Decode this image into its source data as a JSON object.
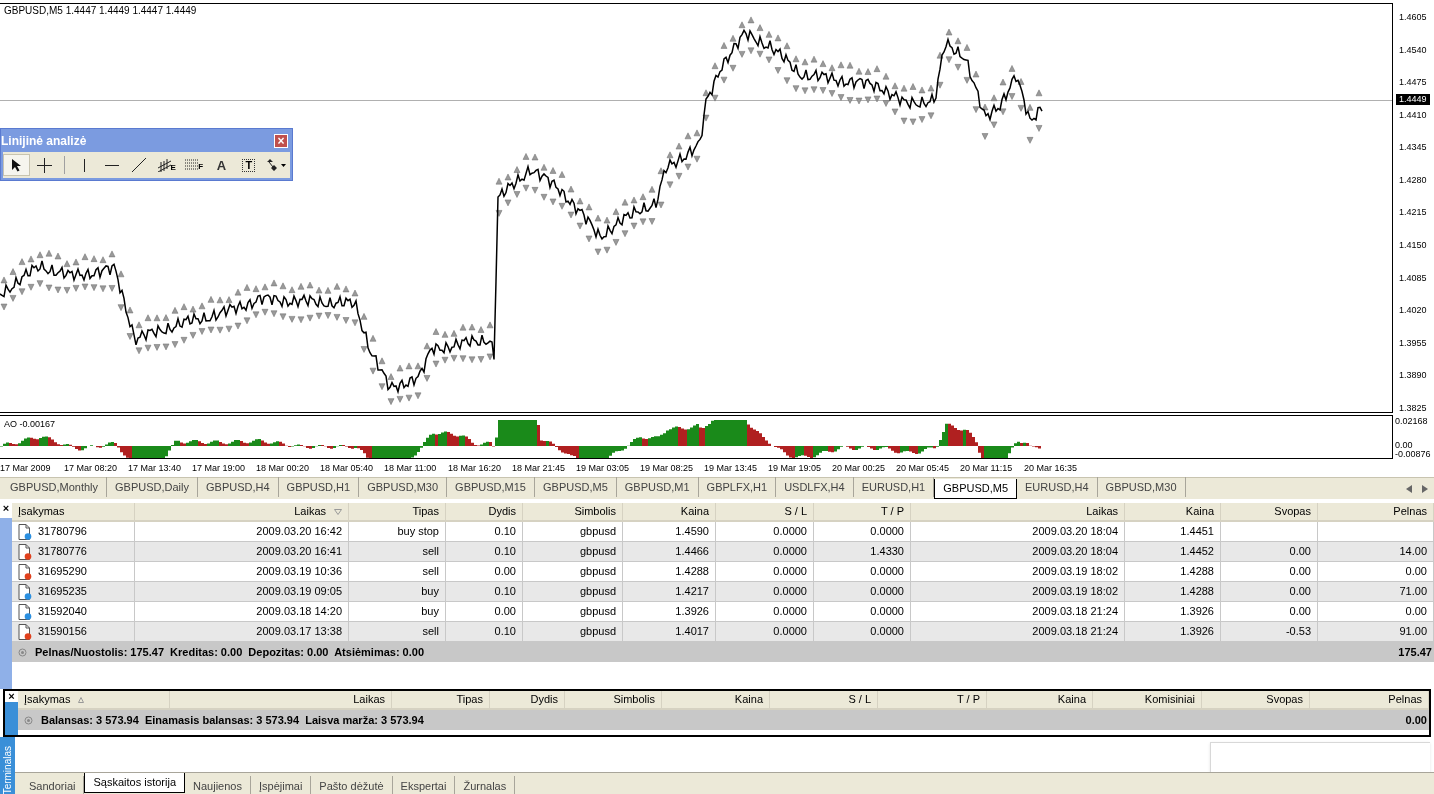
{
  "chart": {
    "header": "GBPUSD,M5  1.4447 1.4449 1.4447 1.4449",
    "price_axis": {
      "labels": [
        "1.4605",
        "1.4540",
        "1.4475",
        "1.4410",
        "1.4345",
        "1.4280",
        "1.4215",
        "1.4150",
        "1.4085",
        "1.4020",
        "1.3955",
        "1.3890",
        "1.3825"
      ],
      "current": "1.4449"
    },
    "indicator": {
      "label": "AO -0.00167",
      "axis": [
        "0.02168",
        "0.00",
        "-0.00876"
      ]
    },
    "time_axis": [
      "17 Mar 2009",
      "17 Mar 08:20",
      "17 Mar 13:40",
      "17 Mar 19:00",
      "18 Mar 00:20",
      "18 Mar 05:40",
      "18 Mar 11:00",
      "18 Mar 16:20",
      "18 Mar 21:45",
      "19 Mar 03:05",
      "19 Mar 08:25",
      "19 Mar 13:45",
      "19 Mar 19:05",
      "20 Mar 00:25",
      "20 Mar 05:45",
      "20 Mar 11:15",
      "20 Mar 16:35"
    ]
  },
  "toolbar": {
    "title": "Linijinė analizė",
    "tools": [
      {
        "kind": "cursor",
        "selected": true
      },
      {
        "kind": "crosshair",
        "selected": false
      },
      {
        "kind": "sep"
      },
      {
        "kind": "vline",
        "selected": false
      },
      {
        "kind": "hline",
        "selected": false
      },
      {
        "kind": "trend",
        "selected": false
      },
      {
        "kind": "channel",
        "label": "E",
        "selected": false
      },
      {
        "kind": "fibo",
        "label": "F",
        "selected": false
      },
      {
        "kind": "text",
        "label": "A",
        "selected": false
      },
      {
        "kind": "textlabel",
        "label": "T",
        "selected": false
      },
      {
        "kind": "arrows",
        "selected": false
      }
    ]
  },
  "chart_tabs": [
    {
      "label": "GBPUSD,Monthly",
      "selected": false
    },
    {
      "label": "GBPUSD,Daily",
      "selected": false
    },
    {
      "label": "GBPUSD,H4",
      "selected": false
    },
    {
      "label": "GBPUSD,H1",
      "selected": false
    },
    {
      "label": "GBPUSD,M30",
      "selected": false
    },
    {
      "label": "GBPUSD,M15",
      "selected": false
    },
    {
      "label": "GBPUSD,M5",
      "selected": false
    },
    {
      "label": "GBPUSD,M1",
      "selected": false
    },
    {
      "label": "GBPLFX,H1",
      "selected": false
    },
    {
      "label": "USDLFX,H4",
      "selected": false
    },
    {
      "label": "EURUSD,H1",
      "selected": false
    },
    {
      "label": "GBPUSD,M5",
      "selected": true
    },
    {
      "label": "EURUSD,H4",
      "selected": false
    },
    {
      "label": "GBPUSD,M30",
      "selected": false
    }
  ],
  "history_table": {
    "columns": [
      "Įsakymas",
      "Laikas",
      "Tipas",
      "Dydis",
      "Simbolis",
      "Kaina",
      "S / L",
      "T / P",
      "Laikas",
      "Kaina",
      "Svopas",
      "Pelnas"
    ],
    "rows": [
      {
        "color": "#2a8fe0",
        "cells": [
          "31780796",
          "2009.03.20 16:42",
          "buy stop",
          "0.10",
          "gbpusd",
          "1.4590",
          "0.0000",
          "0.0000",
          "2009.03.20 18:04",
          "1.4451",
          "",
          ""
        ]
      },
      {
        "color": "#e0401c",
        "cells": [
          "31780776",
          "2009.03.20 16:41",
          "sell",
          "0.10",
          "gbpusd",
          "1.4466",
          "0.0000",
          "1.4330",
          "2009.03.20 18:04",
          "1.4452",
          "0.00",
          "14.00"
        ]
      },
      {
        "color": "#e0401c",
        "cells": [
          "31695290",
          "2009.03.19 10:36",
          "sell",
          "0.00",
          "gbpusd",
          "1.4288",
          "0.0000",
          "0.0000",
          "2009.03.19 18:02",
          "1.4288",
          "0.00",
          "0.00"
        ]
      },
      {
        "color": "#2a8fe0",
        "cells": [
          "31695235",
          "2009.03.19 09:05",
          "buy",
          "0.10",
          "gbpusd",
          "1.4217",
          "0.0000",
          "0.0000",
          "2009.03.19 18:02",
          "1.4288",
          "0.00",
          "71.00"
        ]
      },
      {
        "color": "#2a8fe0",
        "cells": [
          "31592040",
          "2009.03.18 14:20",
          "buy",
          "0.00",
          "gbpusd",
          "1.3926",
          "0.0000",
          "0.0000",
          "2009.03.18 21:24",
          "1.3926",
          "0.00",
          "0.00"
        ]
      },
      {
        "color": "#e0401c",
        "cells": [
          "31590156",
          "2009.03.17 13:38",
          "sell",
          "0.10",
          "gbpusd",
          "1.4017",
          "0.0000",
          "0.0000",
          "2009.03.18 21:24",
          "1.3926",
          "-0.53",
          "91.00"
        ]
      }
    ],
    "summary": "Pelnas/Nuostolis: 175.47  Kreditas: 0.00  Depozitas: 0.00  Atsiėmimas: 0.00",
    "summary_total": "175.47"
  },
  "trade_table": {
    "columns": [
      "Įsakymas",
      "Laikas",
      "Tipas",
      "Dydis",
      "Simbolis",
      "Kaina",
      "S / L",
      "T / P",
      "Kaina",
      "Komisiniai",
      "Svopas",
      "Pelnas"
    ],
    "summary": "Balansas: 3 573.94  Einamasis balansas: 3 573.94  Laisva marža: 3 573.94",
    "summary_total": "0.00"
  },
  "terminal_label": "Terminalas",
  "close_glyph": "×",
  "bottom_tabs": [
    {
      "label": "Sandoriai",
      "selected": false
    },
    {
      "label": "Sąskaitos istorija",
      "selected": true
    },
    {
      "label": "Naujienos",
      "selected": false
    },
    {
      "label": "Įspėjimai",
      "selected": false
    },
    {
      "label": "Pašto dėžutė",
      "selected": false
    },
    {
      "label": "Ekspertai",
      "selected": false
    },
    {
      "label": "Žurnalas",
      "selected": false
    }
  ]
}
